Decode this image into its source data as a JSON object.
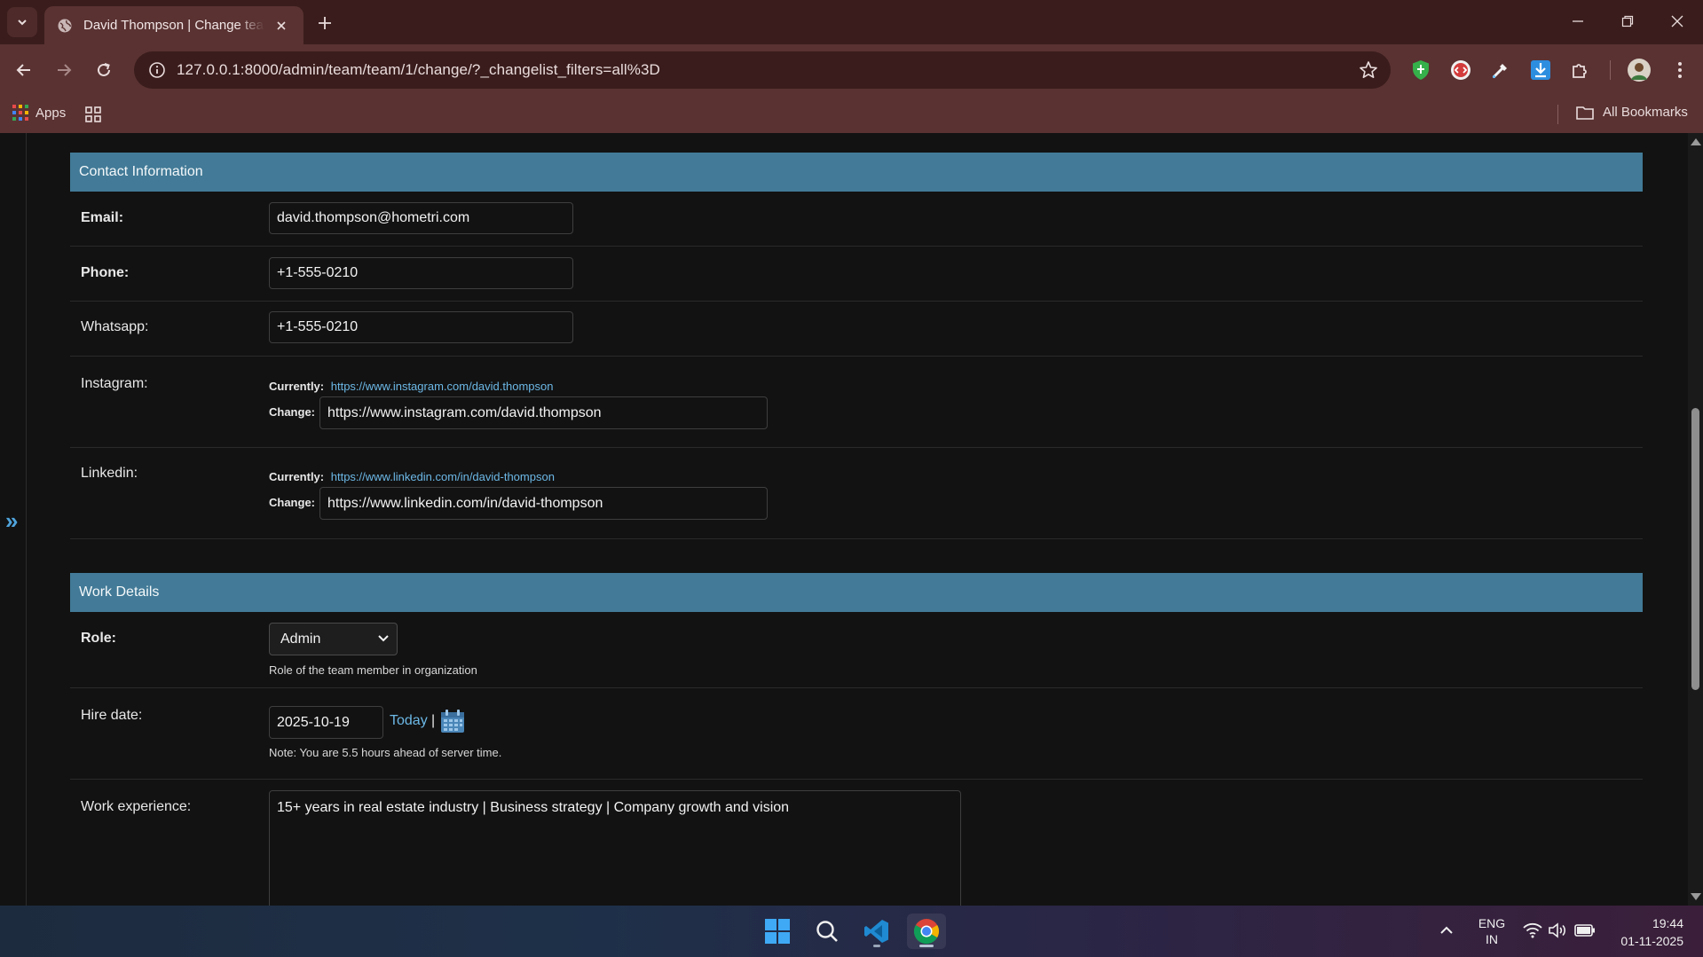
{
  "browser": {
    "tab_title": "David Thompson | Change team member",
    "url": "127.0.0.1:8000/admin/team/team/1/change/?_changelist_filters=all%3D",
    "bookmarks_apps_label": "Apps",
    "all_bookmarks_label": "All Bookmarks",
    "accent_color": "#5a3232"
  },
  "contact": {
    "heading": "Contact Information",
    "email_label": "Email:",
    "email_value": "david.thompson@hometri.com",
    "phone_label": "Phone:",
    "phone_value": "+1-555-0210",
    "whatsapp_label": "Whatsapp:",
    "whatsapp_value": "+1-555-0210",
    "instagram_label": "Instagram:",
    "instagram_currently_label": "Currently:",
    "instagram_currently_link": "https://www.instagram.com/david.thompson",
    "instagram_change_label": "Change:",
    "instagram_value": "https://www.instagram.com/david.thompson",
    "linkedin_label": "Linkedin:",
    "linkedin_currently_label": "Currently:",
    "linkedin_currently_link": "https://www.linkedin.com/in/david-thompson",
    "linkedin_change_label": "Change:",
    "linkedin_value": "https://www.linkedin.com/in/david-thompson"
  },
  "work": {
    "heading": "Work Details",
    "role_label": "Role:",
    "role_value": "Admin",
    "role_help": "Role of the team member in organization",
    "hire_date_label": "Hire date:",
    "hire_date_value": "2025-10-19",
    "today_link": "Today",
    "separator": "|",
    "timezone_note": "Note: You are 5.5 hours ahead of server time.",
    "experience_label": "Work experience:",
    "experience_value": "15+ years in real estate industry | Business strategy | Company growth and vision"
  },
  "colors": {
    "module_header": "#427a97",
    "link": "#6cb8e6",
    "page_bg": "#121212"
  },
  "taskbar": {
    "language": "ENG",
    "region": "IN",
    "time": "19:44",
    "date": "01-11-2025"
  },
  "icons": [
    "chevron-down-icon",
    "globe-icon",
    "close-icon",
    "plus-icon",
    "minimize-icon",
    "restore-icon",
    "back-icon",
    "forward-icon",
    "reload-icon",
    "info-icon",
    "star-icon",
    "shield-icon",
    "devtools-icon",
    "eyedropper-icon",
    "download-icon",
    "puzzle-icon",
    "avatar",
    "menu-dots-icon",
    "apps-grid-icon",
    "folder-icon",
    "calendar-icon",
    "windows-start-icon",
    "search-icon",
    "vscode-icon",
    "chrome-icon",
    "wifi-icon",
    "volume-icon",
    "battery-icon"
  ]
}
